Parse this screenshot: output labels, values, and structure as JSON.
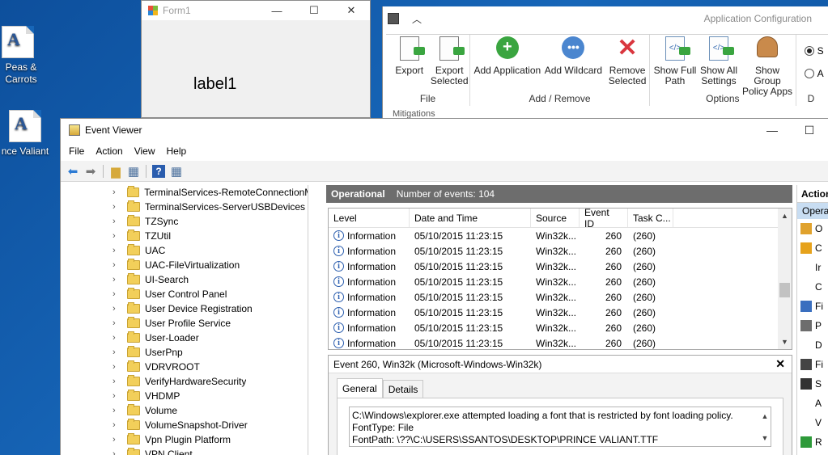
{
  "desktop": {
    "icons": [
      {
        "label": "Peas & Carrots"
      },
      {
        "label": "nce Valiant"
      }
    ]
  },
  "form1": {
    "title": "Form1",
    "label": "label1",
    "controls": {
      "minimize": "—",
      "maximize": "☐",
      "close": "✕"
    }
  },
  "appconfig": {
    "title": "Application Configuration",
    "ribbon": {
      "file": {
        "label": "File",
        "buttons": [
          "Export",
          "Export Selected"
        ]
      },
      "addremove": {
        "label": "Add / Remove",
        "buttons": [
          "Add Application",
          "Add Wildcard",
          "Remove Selected"
        ]
      },
      "options": {
        "label": "Options",
        "buttons": [
          "Show Full Path",
          "Show All Settings",
          "Show Group Policy Apps"
        ]
      },
      "clipped_group_label": "D"
    },
    "mitigations_label": "Mitigations",
    "clipped_radios": [
      "S",
      "A"
    ]
  },
  "eventviewer": {
    "title": "Event Viewer",
    "menu": [
      "File",
      "Action",
      "View",
      "Help"
    ],
    "tree_items": [
      "TerminalServices-RemoteConnectionM",
      "TerminalServices-ServerUSBDevices",
      "TZSync",
      "TZUtil",
      "UAC",
      "UAC-FileVirtualization",
      "UI-Search",
      "User Control Panel",
      "User Device Registration",
      "User Profile Service",
      "User-Loader",
      "UserPnp",
      "VDRVROOT",
      "VerifyHardwareSecurity",
      "VHDMP",
      "Volume",
      "VolumeSnapshot-Driver",
      "Vpn Plugin Platform",
      "VPN Client"
    ],
    "log": {
      "name": "Operational",
      "count_text": "Number of events: 104"
    },
    "columns": [
      "Level",
      "Date and Time",
      "Source",
      "Event ID",
      "Task C..."
    ],
    "rows": [
      {
        "level": "Information",
        "date": "05/10/2015 11:23:15",
        "source": "Win32k...",
        "id": "260",
        "task": "(260)"
      },
      {
        "level": "Information",
        "date": "05/10/2015 11:23:15",
        "source": "Win32k...",
        "id": "260",
        "task": "(260)"
      },
      {
        "level": "Information",
        "date": "05/10/2015 11:23:15",
        "source": "Win32k...",
        "id": "260",
        "task": "(260)"
      },
      {
        "level": "Information",
        "date": "05/10/2015 11:23:15",
        "source": "Win32k...",
        "id": "260",
        "task": "(260)"
      },
      {
        "level": "Information",
        "date": "05/10/2015 11:23:15",
        "source": "Win32k...",
        "id": "260",
        "task": "(260)"
      },
      {
        "level": "Information",
        "date": "05/10/2015 11:23:15",
        "source": "Win32k...",
        "id": "260",
        "task": "(260)"
      },
      {
        "level": "Information",
        "date": "05/10/2015 11:23:15",
        "source": "Win32k...",
        "id": "260",
        "task": "(260)"
      },
      {
        "level": "Information",
        "date": "05/10/2015 11:23:15",
        "source": "Win32k...",
        "id": "260",
        "task": "(260)"
      }
    ],
    "detail": {
      "title": "Event 260, Win32k (Microsoft-Windows-Win32k)",
      "tabs": [
        "General",
        "Details"
      ],
      "message_lines": [
        "C:\\Windows\\explorer.exe attempted loading a font that is restricted by font loading policy.",
        "FontType: File",
        "FontPath: \\??\\C:\\USERS\\SSANTOS\\DESKTOP\\PRINCE VALIANT.TTF"
      ]
    },
    "actions": {
      "header": "Action",
      "subheader": "Opera",
      "items": [
        "O",
        "C",
        "Ir",
        "C",
        "Fi",
        "P",
        "D",
        "Fi",
        "S",
        "A",
        "V",
        "R"
      ]
    }
  },
  "colors": {
    "desktop": "#1766b8",
    "log_header": "#6d6d6d",
    "add_green": "#3aa540",
    "wildcard_blue": "#4b86cf",
    "remove_red": "#d9363e"
  }
}
